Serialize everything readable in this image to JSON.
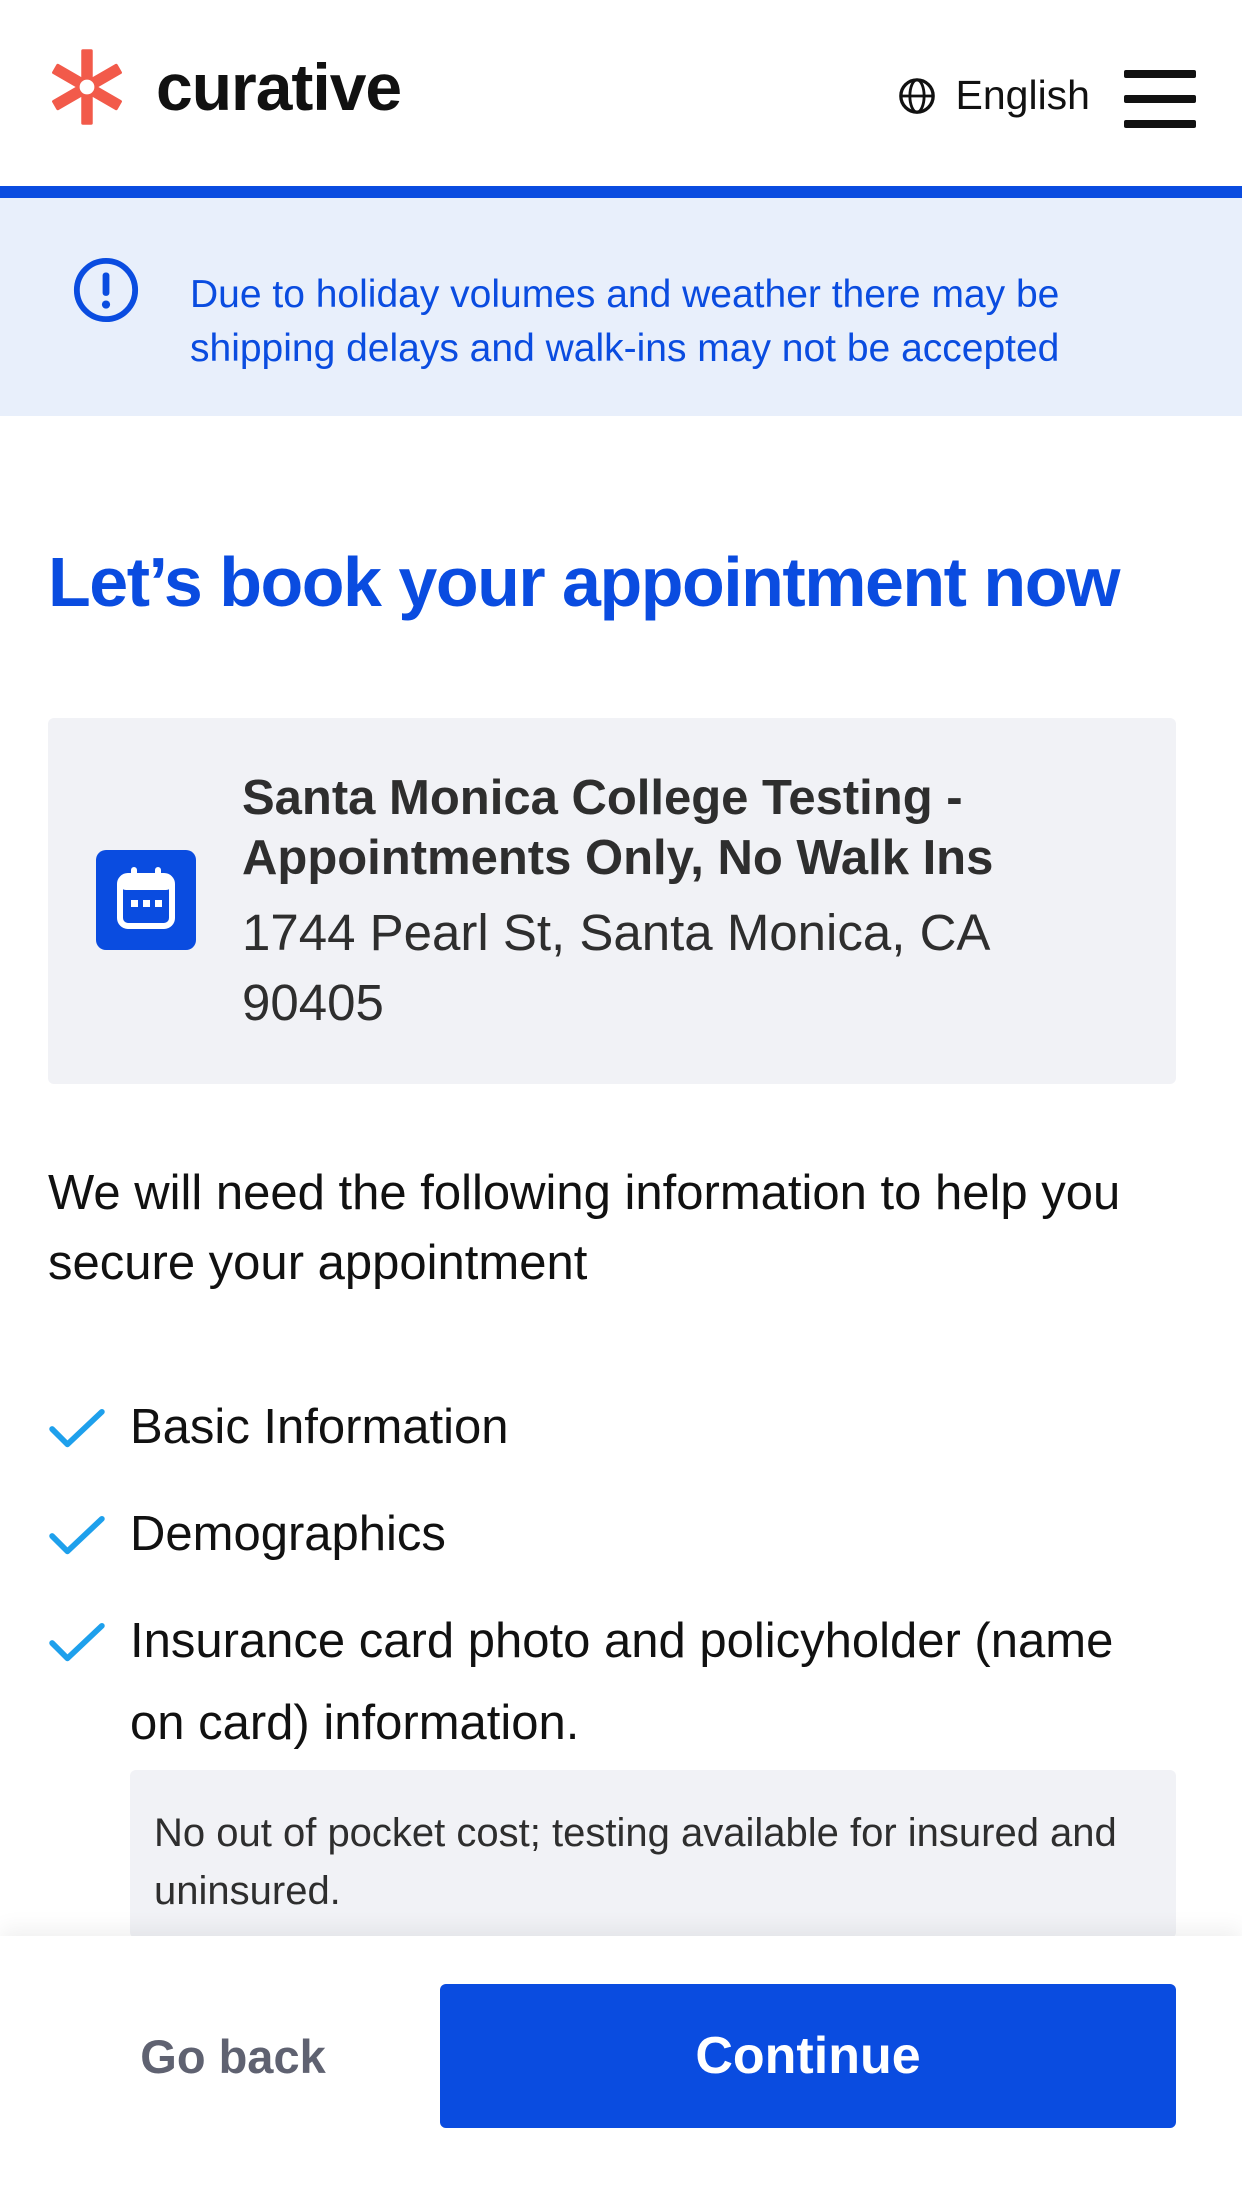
{
  "header": {
    "logo_text": "curative",
    "language_label": "English",
    "icons": {
      "logo": "asterisk-logo-icon",
      "language": "globe-icon",
      "menu": "hamburger-menu-icon"
    }
  },
  "banner": {
    "icon": "alert-circle-icon",
    "message": "Due to holiday volumes and weather there may be shipping delays and walk-ins may not be accepted"
  },
  "page": {
    "title": "Let’s book your appointment now"
  },
  "location": {
    "icon": "calendar-icon",
    "name": "Santa Monica College Testing - Appointments Only, No Walk Ins",
    "address": "1744 Pearl St, Santa Monica, CA 90405"
  },
  "info": {
    "intro": "We will need the following information to help you secure your appointment",
    "checklist": [
      "Basic Information",
      "Demographics",
      "Insurance card photo and policyholder (name on card) information."
    ],
    "note": "No out of pocket cost; testing available for insured and uninsured."
  },
  "footer": {
    "back_label": "Go back",
    "continue_label": "Continue"
  },
  "colors": {
    "brand_blue": "#0a4ce0",
    "logo_coral": "#f25a4a",
    "check_blue": "#1ea0ec",
    "banner_bg": "#e8effb",
    "card_bg": "#f1f2f6"
  }
}
